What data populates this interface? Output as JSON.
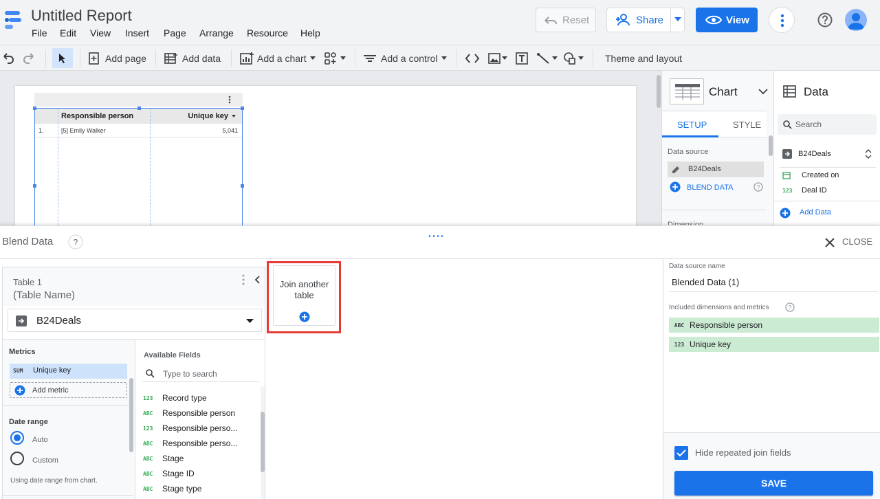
{
  "header": {
    "title": "Untitled Report",
    "menu": [
      "File",
      "Edit",
      "View",
      "Insert",
      "Page",
      "Arrange",
      "Resource",
      "Help"
    ],
    "reset_label": "Reset",
    "share_label": "Share",
    "view_label": "View"
  },
  "toolbar": {
    "add_page": "Add page",
    "add_data": "Add data",
    "add_chart": "Add a chart",
    "add_control": "Add a control",
    "theme": "Theme and layout"
  },
  "canvas": {
    "table": {
      "headers": [
        "Responsible person",
        "Unique key"
      ],
      "row": {
        "index": "1.",
        "person": "[5] Emily Walker",
        "key": "5,041"
      }
    }
  },
  "chart_panel": {
    "title": "Chart",
    "tabs": [
      "SETUP",
      "STYLE"
    ],
    "data_source_label": "Data source",
    "data_source": "B24Deals",
    "blend_label": "BLEND DATA",
    "dimension_label": "Dimension"
  },
  "data_panel": {
    "title": "Data",
    "search_placeholder": "Search",
    "source": "B24Deals",
    "fields": [
      {
        "type": "date",
        "name": "Created on"
      },
      {
        "type": "123",
        "name": "Deal ID"
      }
    ],
    "add_data": "Add Data"
  },
  "blend": {
    "title": "Blend Data",
    "close": "CLOSE",
    "table1": {
      "title": "Table 1",
      "subtitle": "(Table Name)",
      "source": "B24Deals",
      "metrics_label": "Metrics",
      "metric": {
        "agg": "SUM",
        "name": "Unique key"
      },
      "add_metric": "Add metric",
      "date_range_label": "Date range",
      "date_options": [
        "Auto",
        "Custom"
      ],
      "date_note": "Using date range from chart.",
      "available_label": "Available Fields",
      "search_placeholder": "Type to search",
      "fields": [
        {
          "type": "123",
          "name": "Record type"
        },
        {
          "type": "ABC",
          "name": "Responsible person"
        },
        {
          "type": "123",
          "name": "Responsible perso..."
        },
        {
          "type": "ABC",
          "name": "Responsible perso..."
        },
        {
          "type": "ABC",
          "name": "Stage"
        },
        {
          "type": "ABC",
          "name": "Stage ID"
        },
        {
          "type": "ABC",
          "name": "Stage type"
        }
      ]
    },
    "join_tile": {
      "line1": "Join another",
      "line2": "table"
    },
    "config": {
      "name_label": "Data source name",
      "name": "Blended Data (1)",
      "included_label": "Included dimensions and metrics",
      "included": [
        {
          "type": "ABC",
          "name": "Responsible person"
        },
        {
          "type": "123",
          "name": "Unique key"
        }
      ],
      "hide_label": "Hide repeated join fields",
      "save": "SAVE"
    }
  },
  "colors": {
    "accent": "#1a73e8",
    "highlight": "#e53935",
    "chip": "#ccebd3"
  }
}
